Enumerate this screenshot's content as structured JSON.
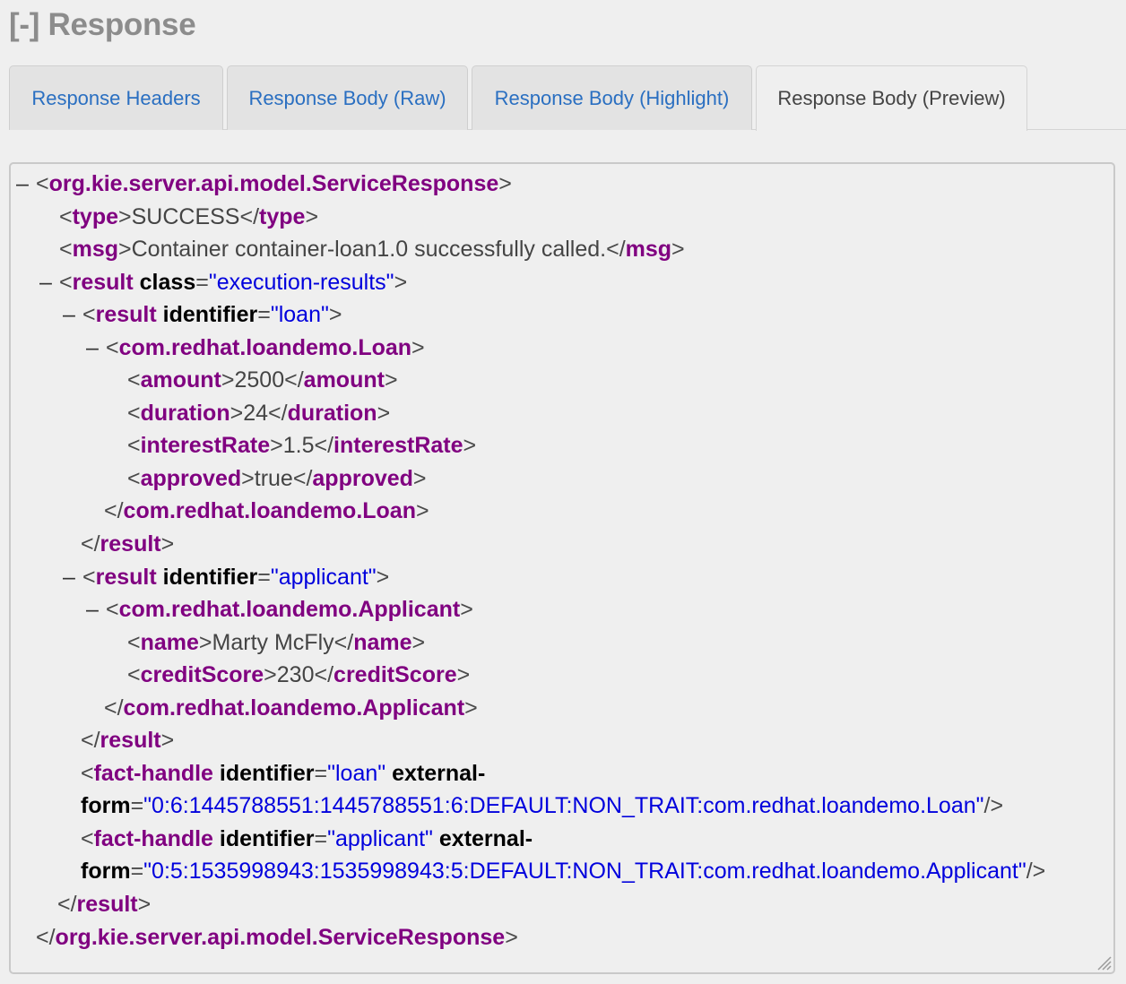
{
  "header": {
    "collapse_marker": "[-]",
    "title": "Response"
  },
  "tabs": [
    {
      "label": "Response Headers",
      "active": false
    },
    {
      "label": "Response Body (Raw)",
      "active": false
    },
    {
      "label": "Response Body (Highlight)",
      "active": false
    },
    {
      "label": "Response Body (Preview)",
      "active": true
    }
  ],
  "colors": {
    "tag": "#800080",
    "attribute": "#000000",
    "attribute_value": "#0000dd",
    "link_tab": "#2a6fc1",
    "title": "#8c8c8c"
  },
  "xml": {
    "toggle": "–",
    "root_tag": "org.kie.server.api.model.ServiceResponse",
    "type_tag": "type",
    "type_value": "SUCCESS",
    "msg_tag": "msg",
    "msg_value": "Container container-loan1.0 successfully called.",
    "result_tag": "result",
    "class_attr": "class",
    "class_value": "\"execution-results\"",
    "identifier_attr": "identifier",
    "loan_id": "\"loan\"",
    "loan_tag": "com.redhat.loandemo.Loan",
    "amount_tag": "amount",
    "amount_value": "2500",
    "duration_tag": "duration",
    "duration_value": "24",
    "interest_tag": "interestRate",
    "interest_value": "1.5",
    "approved_tag": "approved",
    "approved_value": "true",
    "applicant_id": "\"applicant\"",
    "applicant_tag": "com.redhat.loandemo.Applicant",
    "name_tag": "name",
    "name_value": "Marty McFly",
    "credit_tag": "creditScore",
    "credit_value": "230",
    "fact_tag": "fact-handle",
    "external_attr_a": "external-",
    "external_attr_b": "form",
    "fact1_form": "\"0:6:1445788551:1445788551:6:DEFAULT:NON_TRAIT:com.redhat.loandemo.Loan\"",
    "fact2_form": "\"0:5:1535998943:1535998943:5:DEFAULT:NON_TRAIT:com.redhat.loandemo.Applicant\""
  }
}
